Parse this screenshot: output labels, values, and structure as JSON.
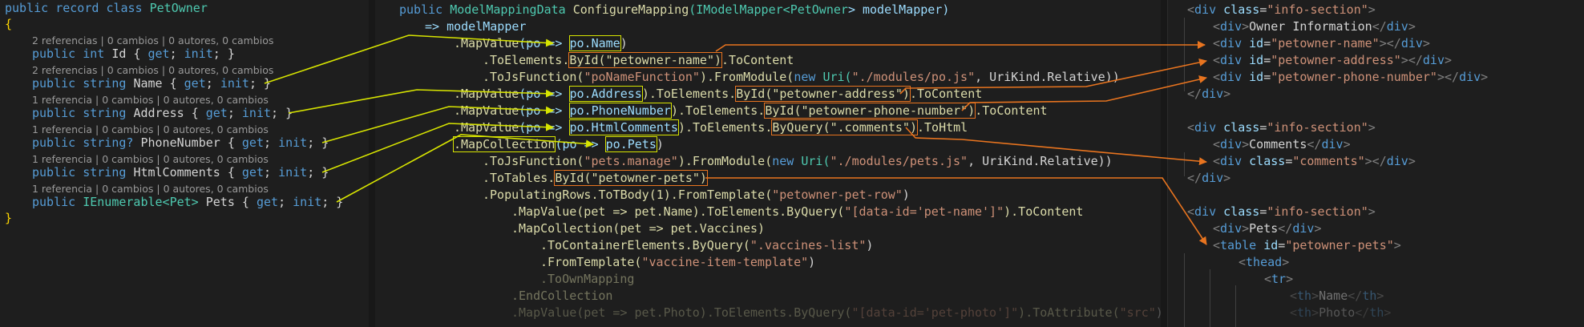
{
  "colors": {
    "yellow_arrow": "#d7e400",
    "orange_arrow": "#e8741f",
    "background": "#1e1e1e"
  },
  "left": {
    "decl": [
      "public",
      "record",
      "class",
      "PetOwner"
    ],
    "open_brace": "{",
    "close_brace": "}",
    "lens": [
      "2 referencias | 0 cambios | 0 autores, 0 cambios",
      "2 referencias | 0 cambios | 0 autores, 0 cambios",
      "1 referencia | 0 cambios | 0 autores, 0 cambios",
      "1 referencia | 0 cambios | 0 autores, 0 cambios",
      "1 referencia | 0 cambios | 0 autores, 0 cambios",
      "1 referencia | 0 cambios | 0 autores, 0 cambios"
    ],
    "props": [
      {
        "mod": "public",
        "type": "int",
        "name": "Id"
      },
      {
        "mod": "public",
        "type": "string",
        "name": "Name"
      },
      {
        "mod": "public",
        "type": "string",
        "name": "Address"
      },
      {
        "mod": "public",
        "type": "string?",
        "name": "PhoneNumber"
      },
      {
        "mod": "public",
        "type": "string",
        "name": "HtmlComments"
      },
      {
        "mod": "public",
        "type": "IEnumerable<Pet>",
        "name": "Pets"
      }
    ],
    "accessor": "{ get; init; }",
    "get_kw": "get",
    "init_kw": "init"
  },
  "mid": {
    "l0": {
      "a": "public",
      "b": "ModelMappingData",
      "c": "ConfigureMapping",
      "d": "(IModelMapper<",
      "e": "PetOwner",
      "f": "> modelMapper)"
    },
    "l1": "=> modelMapper",
    "l2": {
      "a": ".MapValue",
      "b": "(po => ",
      "c": "po.Name",
      "d": ")"
    },
    "l3": {
      "a": ".ToElements.",
      "b": "ById(\"petowner-name\")",
      "c": ".ToContent"
    },
    "l4": {
      "a": ".ToJsFunction(",
      "b": "\"poNameFunction\"",
      "c": ").FromModule(",
      "d": "new",
      "e": " Uri(",
      "f": "\"./modules/po.js\"",
      "g": ", UriKind.Relative))"
    },
    "l5": {
      "a": ".MapValue",
      "b": "(po => ",
      "c": "po.Address",
      "d": ").ToElements.",
      "e": "ById(\"petowner-address\")",
      "f": ".ToContent"
    },
    "l6": {
      "a": ".MapValue",
      "b": "(po => ",
      "c": "po.PhoneNumber",
      "d": ").ToElements.",
      "e": "ById(\"petowner-phone-number\")",
      "f": ".ToContent"
    },
    "l7": {
      "a": ".MapValue",
      "b": "(po => ",
      "c": "po.HtmlComments",
      "d": ").ToElements.",
      "e": "ByQuery(\".comments\")",
      "f": ".ToHtml"
    },
    "l8": {
      "a": ".MapCollection",
      "b": "(po => ",
      "c": "po.Pets",
      "d": ")"
    },
    "l9": {
      "a": ".ToJsFunction(",
      "b": "\"pets.manage\"",
      "c": ").FromModule(",
      "d": "new",
      "e": " Uri(",
      "f": "\"./modules/pets.js\"",
      "g": ", UriKind.Relative))"
    },
    "l10": {
      "a": ".ToTables.",
      "b": "ById(\"petowner-pets\")"
    },
    "l11": {
      "a": ".PopulatingRows.ToTBody(1).FromTemplate(",
      "b": "\"petowner-pet-row\"",
      "c": ")"
    },
    "l12": {
      "a": ".MapValue(pet => pet.Name).ToElements.ByQuery(",
      "b": "\"[data-id='pet-name']\"",
      "c": ").ToContent"
    },
    "l13": {
      "a": ".MapCollection(pet => pet.Vaccines)"
    },
    "l14": {
      "a": ".ToContainerElements.ByQuery(",
      "b": "\".vaccines-list\"",
      "c": ")"
    },
    "l15": {
      "a": ".FromTemplate(",
      "b": "\"vaccine-item-template\"",
      "c": ")"
    },
    "l16": ".ToOwnMapping",
    "l17": ".EndCollection",
    "l18": {
      "a": ".MapValue(pet => pet.Photo).ToElements.ByQuery(",
      "b": "\"[data-id='pet-photo']\"",
      "c": ").ToAttribute(",
      "d": "\"src\"",
      "e": ")"
    }
  },
  "right": {
    "div": "div",
    "cls": "class",
    "id": "id",
    "table": "table",
    "thead": "thead",
    "tr": "tr",
    "th": "th",
    "sec_val": "\"info-section\"",
    "owner_info": "Owner Information",
    "petowner_name": "\"petowner-name\"",
    "petowner_address": "\"petowner-address\"",
    "petowner_phone": "\"petowner-phone-number\"",
    "comments_text": "Comments",
    "comments_cls": "\"comments\"",
    "pets_text": "Pets",
    "petowner_pets": "\"petowner-pets\"",
    "th_name": "Name",
    "th_photo": "Photo"
  }
}
